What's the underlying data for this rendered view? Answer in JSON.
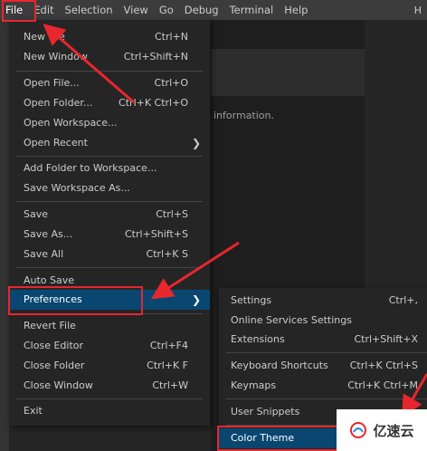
{
  "menubar": {
    "items": [
      "File",
      "Edit",
      "Selection",
      "View",
      "Go",
      "Debug",
      "Terminal",
      "Help"
    ],
    "right_fragment": "H"
  },
  "background": {
    "info_fragment": "information."
  },
  "file_menu": {
    "items": [
      {
        "label": "New File",
        "shortcut": "Ctrl+N"
      },
      {
        "label": "New Window",
        "shortcut": "Ctrl+Shift+N"
      },
      {
        "label": "Open File...",
        "shortcut": "Ctrl+O"
      },
      {
        "label": "Open Folder...",
        "shortcut": "Ctrl+K Ctrl+O"
      },
      {
        "label": "Open Workspace...",
        "shortcut": ""
      },
      {
        "label": "Open Recent",
        "shortcut": ""
      },
      {
        "label": "Add Folder to Workspace...",
        "shortcut": ""
      },
      {
        "label": "Save Workspace As...",
        "shortcut": ""
      },
      {
        "label": "Save",
        "shortcut": "Ctrl+S"
      },
      {
        "label": "Save As...",
        "shortcut": "Ctrl+Shift+S"
      },
      {
        "label": "Save All",
        "shortcut": "Ctrl+K S"
      },
      {
        "label": "Auto Save",
        "shortcut": ""
      },
      {
        "label": "Preferences",
        "shortcut": ""
      },
      {
        "label": "Revert File",
        "shortcut": ""
      },
      {
        "label": "Close Editor",
        "shortcut": "Ctrl+F4"
      },
      {
        "label": "Close Folder",
        "shortcut": "Ctrl+K F"
      },
      {
        "label": "Close Window",
        "shortcut": "Ctrl+W"
      },
      {
        "label": "Exit",
        "shortcut": ""
      }
    ]
  },
  "preferences_menu": {
    "items": [
      {
        "label": "Settings",
        "shortcut": "Ctrl+,"
      },
      {
        "label": "Online Services Settings",
        "shortcut": ""
      },
      {
        "label": "Extensions",
        "shortcut": "Ctrl+Shift+X"
      },
      {
        "label": "Keyboard Shortcuts",
        "shortcut": "Ctrl+K Ctrl+S"
      },
      {
        "label": "Keymaps",
        "shortcut": "Ctrl+K Ctrl+M"
      },
      {
        "label": "User Snippets",
        "shortcut": ""
      },
      {
        "label": "Color Theme",
        "shortcut": ""
      }
    ]
  },
  "annotation_color": "#e8262d",
  "selection_color": "#094771",
  "watermark": {
    "text": "亿速云"
  }
}
